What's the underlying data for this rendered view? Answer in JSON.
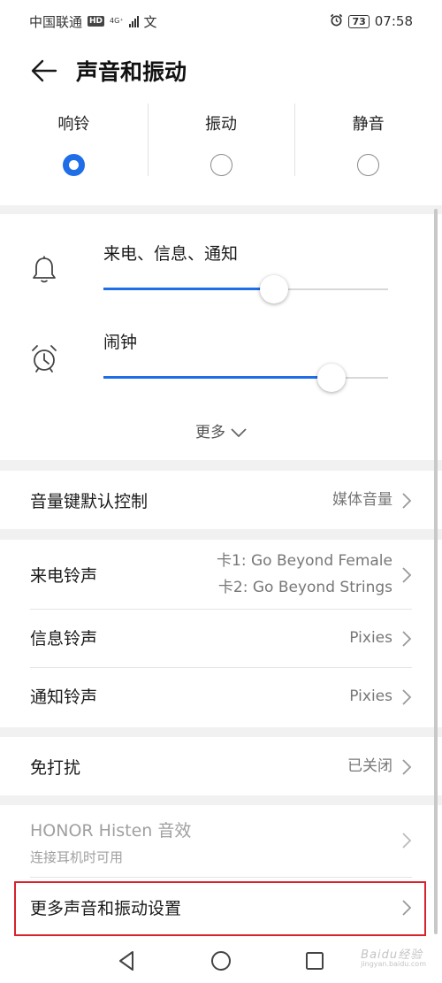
{
  "status_bar": {
    "carrier": "中国联通",
    "hd_badge": "HD",
    "network": "4G⁺",
    "extra_icon": "文",
    "battery": "73",
    "time": "07:58",
    "icons": [
      "signal-icon",
      "alarm-icon",
      "battery-icon"
    ]
  },
  "header": {
    "title": "声音和振动",
    "back_icon": "arrow-left-icon"
  },
  "modes": [
    {
      "label": "响铃",
      "selected": true
    },
    {
      "label": "振动",
      "selected": false
    },
    {
      "label": "静音",
      "selected": false
    }
  ],
  "volume": {
    "items": [
      {
        "label": "来电、信息、通知",
        "icon": "bell-icon",
        "level": 0.6
      },
      {
        "label": "闹钟",
        "icon": "alarm-clock-icon",
        "level": 0.8
      }
    ],
    "more_label": "更多"
  },
  "settings": {
    "volume_key": {
      "title": "音量键默认控制",
      "value": "媒体音量"
    },
    "ringtone": {
      "title": "来电铃声",
      "value_line1": "卡1: Go Beyond Female",
      "value_line2": "卡2: Go Beyond Strings"
    },
    "message_tone": {
      "title": "信息铃声",
      "value": "Pixies"
    },
    "notification_tone": {
      "title": "通知铃声",
      "value": "Pixies"
    },
    "dnd": {
      "title": "免打扰",
      "value": "已关闭"
    },
    "histen": {
      "title": "HONOR Histen 音效",
      "subtitle": "连接耳机时可用"
    },
    "more_settings": {
      "title": "更多声音和振动设置"
    }
  },
  "nav_bar": {
    "icons": [
      "back-triangle-icon",
      "home-circle-icon",
      "recents-square-icon"
    ]
  },
  "watermark": {
    "text": "Baidu经验",
    "sub": "jingyan.baidu.com"
  },
  "colors": {
    "accent": "#1f6ee8",
    "highlight": "#d8222c",
    "background": "#f1f1f1"
  }
}
